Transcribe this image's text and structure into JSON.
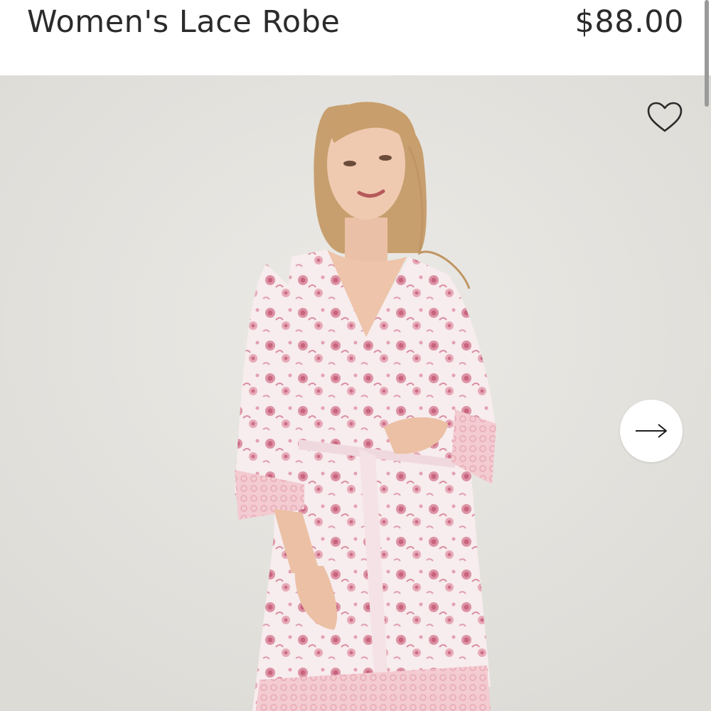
{
  "product": {
    "title": "Women's Lace Robe",
    "price": "$88.00"
  },
  "gallery": {
    "image_label": "model-wearing-pink-floral-robe",
    "favorite_icon": "heart-outline-icon",
    "next_icon": "arrow-right-icon"
  },
  "colors": {
    "text": "#2b2b2b",
    "background": "#e4e3df",
    "robe_base": "#f6e9ec",
    "robe_print": "#d9849a",
    "lace": "#f2c9cf"
  }
}
